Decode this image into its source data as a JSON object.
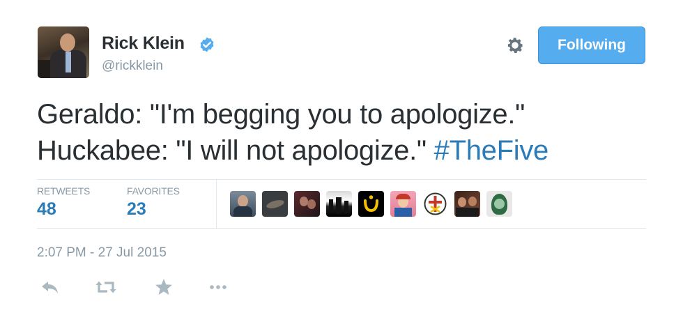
{
  "author": {
    "name": "Rick Klein",
    "handle": "@rickklein",
    "verified_icon": "verified-badge-icon"
  },
  "follow_button": {
    "label": "Following"
  },
  "tweet": {
    "line1": "Geraldo: \"I'm begging you to apologize.\"",
    "line2": "Huckabee: \"I will not apologize.\" ",
    "hashtag": "#TheFive"
  },
  "stats": {
    "retweets_label": "RETWEETS",
    "retweets_value": "48",
    "favorites_label": "FAVORITES",
    "favorites_value": "23"
  },
  "favoriter_avatars": [
    {
      "name": "favoriter-avatar-1"
    },
    {
      "name": "favoriter-avatar-2"
    },
    {
      "name": "favoriter-avatar-3"
    },
    {
      "name": "favoriter-avatar-4"
    },
    {
      "name": "favoriter-avatar-5"
    },
    {
      "name": "favoriter-avatar-6"
    },
    {
      "name": "favoriter-avatar-7"
    },
    {
      "name": "favoriter-avatar-8"
    },
    {
      "name": "favoriter-avatar-9"
    }
  ],
  "timestamp": "2:07 PM - 27 Jul 2015",
  "actions": [
    "reply-icon",
    "retweet-icon",
    "favorite-star-icon",
    "more-icon"
  ],
  "colors": {
    "accent": "#55acee",
    "link": "#2b7bb9",
    "muted": "#8899a6",
    "text": "#292f33"
  }
}
